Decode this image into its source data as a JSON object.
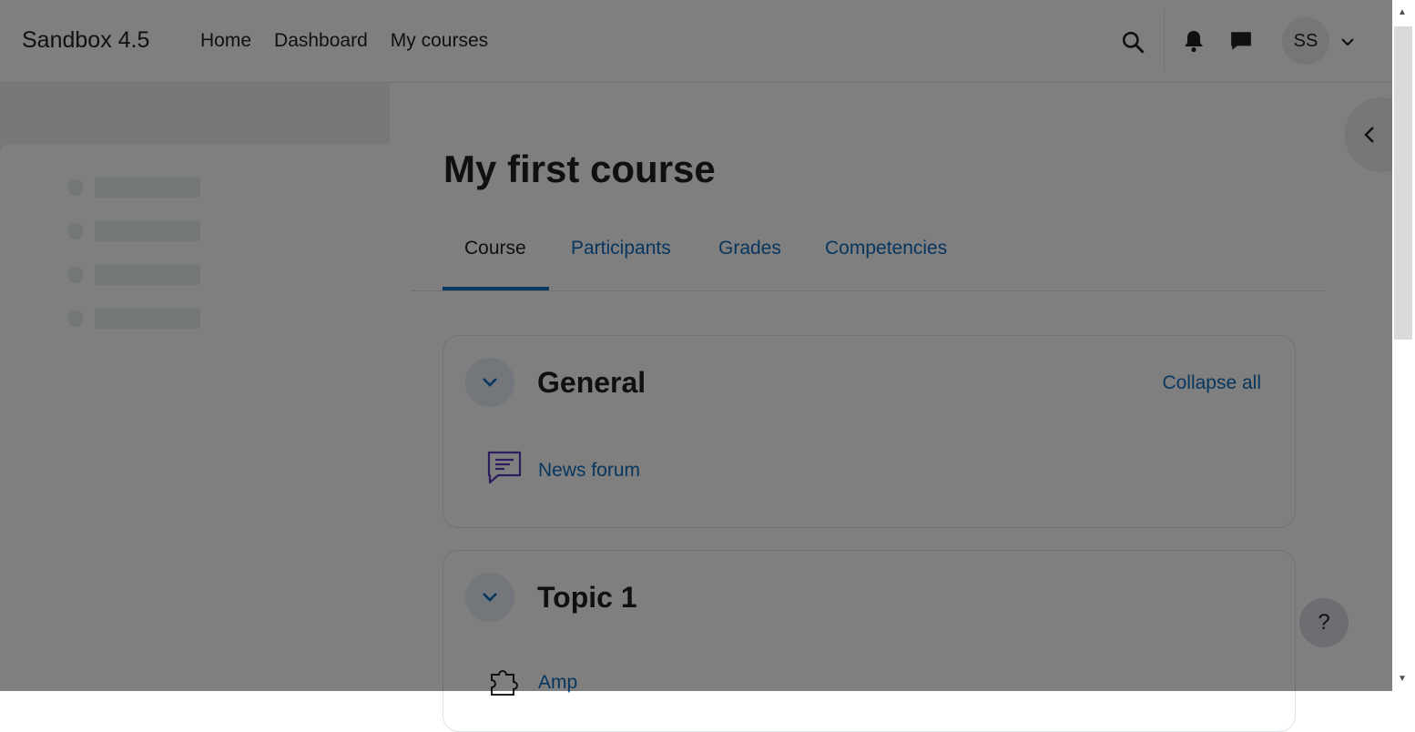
{
  "site": {
    "brand": "Sandbox 4.5"
  },
  "nav": {
    "items": [
      "Home",
      "Dashboard",
      "My courses"
    ]
  },
  "user": {
    "initials": "SS"
  },
  "page": {
    "title": "My first course"
  },
  "tabs": [
    {
      "label": "Course",
      "active": true
    },
    {
      "label": "Participants",
      "active": false
    },
    {
      "label": "Grades",
      "active": false
    },
    {
      "label": "Competencies",
      "active": false
    }
  ],
  "sections": [
    {
      "title": "General",
      "action": "Collapse all",
      "activities": [
        {
          "name": "News forum",
          "icon": "forum-icon"
        }
      ]
    },
    {
      "title": "Topic 1",
      "activities": [
        {
          "name": "Amp",
          "icon": "puzzle-icon"
        }
      ]
    }
  ],
  "help": {
    "label": "?"
  },
  "colors": {
    "link": "#0f6cbf",
    "text": "#1d2125",
    "forum_icon": "#5b3bbf"
  }
}
